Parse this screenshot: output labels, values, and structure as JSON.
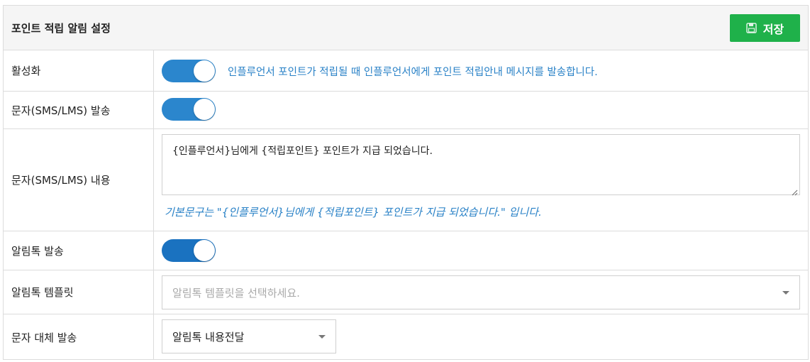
{
  "header": {
    "title": "포인트 적립 알림 설정",
    "save_label": "저장"
  },
  "rows": {
    "activation": {
      "label": "활성화",
      "enabled": true,
      "hint": "인플루언서 포인트가 적립될 때 인플루언서에게 포인트 적립안내 메시지를 발송합니다."
    },
    "sms_send": {
      "label": "문자(SMS/LMS) 발송",
      "enabled": true
    },
    "sms_content": {
      "label": "문자(SMS/LMS) 내용",
      "value": "{인플루언서}님에게 {적립포인트} 포인트가 지급 되었습니다.",
      "default_hint": "기본문구는 \"{인플루언서}님에게 {적립포인트} 포인트가 지급 되었습니다.\" 입니다."
    },
    "alimtalk_send": {
      "label": "알림톡 발송",
      "enabled": true
    },
    "alimtalk_template": {
      "label": "알림톡 템플릿",
      "placeholder": "알림톡 템플릿을 선택하세요."
    },
    "fallback_send": {
      "label": "문자 대체 발송",
      "selected": "알림톡 내용전달"
    }
  },
  "colors": {
    "save_button": "#1fb14a",
    "toggle_on": "#2b86cd",
    "hint_text": "#2a82c7"
  },
  "icons": {
    "save": "floppy-disk-icon",
    "dropdown": "caret-down-icon",
    "resize": "resize-grip-icon"
  }
}
